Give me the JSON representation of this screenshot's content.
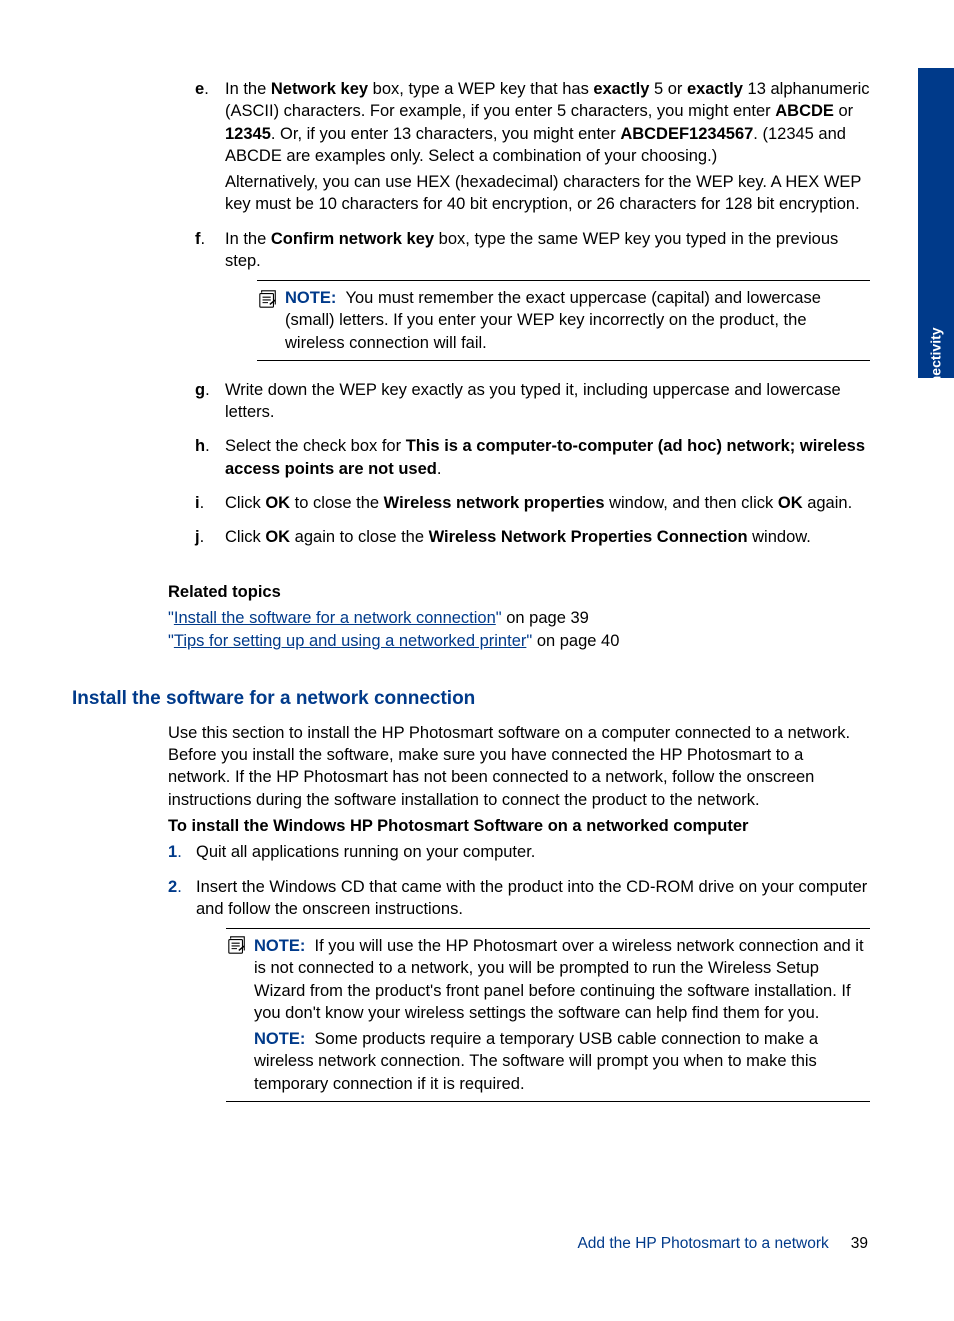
{
  "sideTab": "Connectivity",
  "steps": {
    "e": {
      "marker": "e",
      "p1_html": "In the <b>Network key</b> box, type a WEP key that has <b>exactly</b> 5 or <b>exactly</b> 13 alphanumeric (ASCII) characters. For example, if you enter 5 characters, you might enter <b>ABCDE</b> or <b>12345</b>. Or, if you enter 13 characters, you might enter <b>ABCDEF1234567</b>. (12345 and ABCDE are examples only. Select a combination of your choosing.)",
      "p2": "Alternatively, you can use HEX (hexadecimal) characters for the WEP key. A HEX WEP key must be 10 characters for 40 bit encryption, or 26 characters for 128 bit encryption."
    },
    "f": {
      "marker": "f",
      "p1_html": "In the <b>Confirm network key</b> box, type the same WEP key you typed in the previous step.",
      "note_label": "NOTE:",
      "note_text": "You must remember the exact uppercase (capital) and lowercase (small) letters. If you enter your WEP key incorrectly on the product, the wireless connection will fail."
    },
    "g": {
      "marker": "g",
      "text": "Write down the WEP key exactly as you typed it, including uppercase and lowercase letters."
    },
    "h": {
      "marker": "h",
      "p1_html": "Select the check box for <b>This is a computer-to-computer (ad hoc) network; wireless access points are not used</b>."
    },
    "i": {
      "marker": "i",
      "p1_html": "Click <b>OK</b> to close the <b>Wireless network properties</b> window, and then click <b>OK</b> again."
    },
    "j": {
      "marker": "j",
      "p1_html": "Click <b>OK</b> again to close the <b>Wireless Network Properties Connection</b> window."
    }
  },
  "related": {
    "heading": "Related topics",
    "link1_text": "Install the software for a network connection",
    "link1_suffix": " on page 39",
    "link2_text": "Tips for setting up and using a networked printer",
    "link2_suffix": " on page 40"
  },
  "section2": {
    "heading": "Install the software for a network connection",
    "intro": "Use this section to install the HP Photosmart software on a computer connected to a network. Before you install the software, make sure you have connected the HP Photosmart to a network. If the HP Photosmart has not been connected to a network, follow the onscreen instructions during the software installation to connect the product to the network.",
    "sub_heading": "To install the Windows HP Photosmart Software on a networked computer",
    "items": {
      "1": {
        "marker": "1",
        "text": "Quit all applications running on your computer."
      },
      "2": {
        "marker": "2",
        "text": "Insert the Windows CD that came with the product into the CD-ROM drive on your computer and follow the onscreen instructions.",
        "note1_label": "NOTE:",
        "note1_text": "If you will use the HP Photosmart over a wireless network connection and it is not connected to a network, you will be prompted to run the Wireless Setup Wizard from the product's front panel before continuing the software installation. If you don't know your wireless settings the software can help find them for you.",
        "note2_label": "NOTE:",
        "note2_text": "Some products require a temporary USB cable connection to make a wireless network connection. The software will prompt you when to make this temporary connection if it is required."
      }
    }
  },
  "footer": {
    "text": "Add the HP Photosmart to a network",
    "page": "39"
  }
}
